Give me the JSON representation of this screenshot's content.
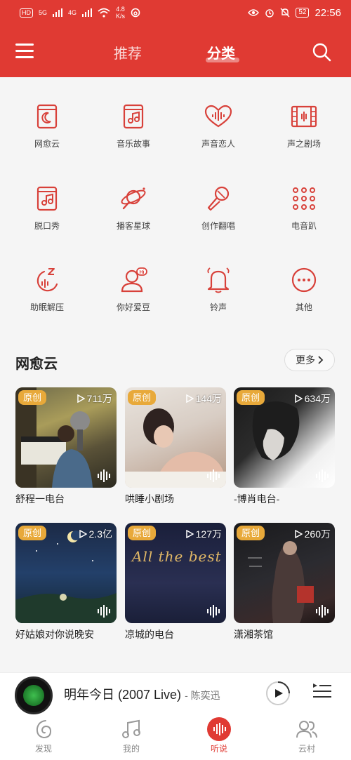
{
  "status_bar": {
    "hd_label": "HD",
    "signal1": "5G",
    "signal2": "4G",
    "speed_value": "4.8",
    "speed_unit": "K/s",
    "battery": "52",
    "time": "22:56"
  },
  "header": {
    "tabs": [
      {
        "label": "推荐",
        "active": false
      },
      {
        "label": "分类",
        "active": true
      }
    ]
  },
  "categories": [
    {
      "label": "网愈云",
      "icon": "book-moon-icon"
    },
    {
      "label": "音乐故事",
      "icon": "music-book-icon"
    },
    {
      "label": "声音恋人",
      "icon": "sound-heart-icon"
    },
    {
      "label": "声之剧场",
      "icon": "film-theater-icon"
    },
    {
      "label": "脱口秀",
      "icon": "music-book-icon"
    },
    {
      "label": "播客星球",
      "icon": "planet-mic-icon"
    },
    {
      "label": "创作翻唱",
      "icon": "microphone-icon"
    },
    {
      "label": "电音趴",
      "icon": "dots-grid-icon"
    },
    {
      "label": "助眠解压",
      "icon": "sleep-icon"
    },
    {
      "label": "你好爱豆",
      "icon": "idol-hi-icon"
    },
    {
      "label": "铃声",
      "icon": "bell-icon"
    },
    {
      "label": "其他",
      "icon": "more-circle-icon"
    }
  ],
  "section": {
    "title": "网愈云",
    "more_label": "更多"
  },
  "cards": [
    {
      "badge": "原创",
      "plays": "711万",
      "title": "舒程一电台"
    },
    {
      "badge": "原创",
      "plays": "144万",
      "title": "哄睡小剧场"
    },
    {
      "badge": "原创",
      "plays": "634万",
      "title": "-博肖电台-"
    },
    {
      "badge": "原创",
      "plays": "2.3亿",
      "title": "好姑娘对你说晚安",
      "cover_text": ""
    },
    {
      "badge": "原创",
      "plays": "127万",
      "title": "凉城的电台",
      "cover_text": "All the best"
    },
    {
      "badge": "原创",
      "plays": "260万",
      "title": "潇湘茶馆"
    }
  ],
  "player": {
    "song": "明年今日 (2007 Live)",
    "artist": "- 陈奕迅"
  },
  "bottom_nav": [
    {
      "label": "发现",
      "active": false
    },
    {
      "label": "我的",
      "active": false
    },
    {
      "label": "听说",
      "active": true
    },
    {
      "label": "云村",
      "active": false
    }
  ],
  "colors": {
    "brand_red": "#e03a33",
    "badge_gold": "#e8a93a"
  }
}
